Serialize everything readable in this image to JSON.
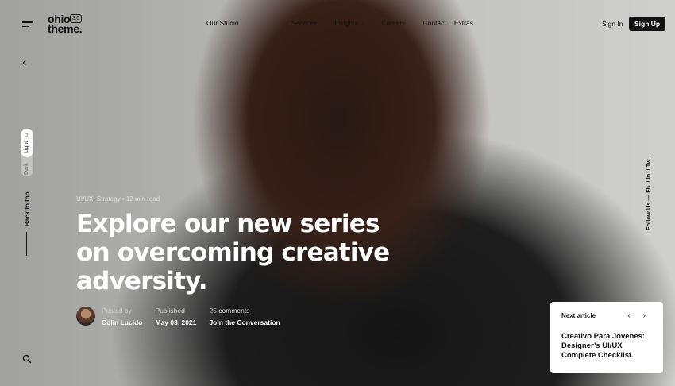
{
  "brand": {
    "logo_text": "ohio theme.",
    "version": "3.0"
  },
  "nav": [
    "Our Studio",
    "Services",
    "Insights",
    "Careers",
    "Contact",
    "Extras"
  ],
  "auth": {
    "sign_in": "Sign In",
    "sign_up": "Sign Up"
  },
  "left_rail": {
    "mode_light": "Light",
    "mode_dark": "Dark",
    "back_to_top": "Back to top"
  },
  "right_rail": {
    "social": "Follow Us — Fb. / In. / Tw."
  },
  "article": {
    "meta": "UI/UX, Strategy • 12 min read",
    "headline_lines": [
      "Explore our new series",
      "on overcoming creative",
      "adversity."
    ],
    "posted_by_label": "Posted by",
    "author": "Colin Lucido",
    "published_label": "Published",
    "published_date": "May 03, 2021",
    "comments_label": "25 comments",
    "comments_link": "Join the Conversation"
  },
  "next_article": {
    "label": "Next article",
    "title": "Creativo Para Jóvenes: Designer’s UI/UX Complete Checklist."
  },
  "icons": [
    "hamburger-icon",
    "back-arrow-icon",
    "sun-icon",
    "search-icon",
    "chevron-left-icon",
    "chevron-right-icon"
  ]
}
